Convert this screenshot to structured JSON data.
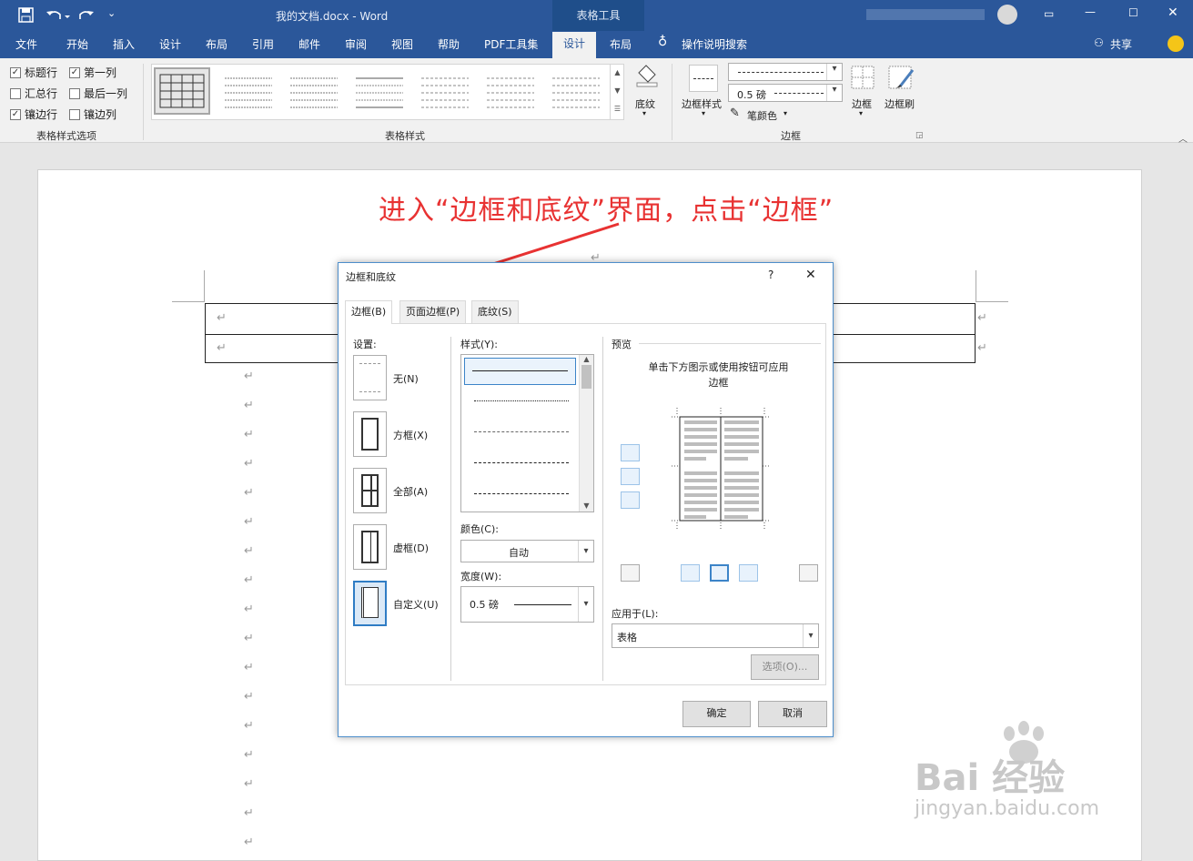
{
  "window": {
    "title": "我的文档.docx  -  Word",
    "context_tab": "表格工具",
    "share_label": "共享",
    "tell_me": "操作说明搜索"
  },
  "tabs": [
    "文件",
    "开始",
    "插入",
    "设计",
    "布局",
    "引用",
    "邮件",
    "审阅",
    "视图",
    "帮助",
    "PDF工具集",
    "设计",
    "布局"
  ],
  "ribbon": {
    "options_group": {
      "label": "表格样式选项",
      "checkboxes": [
        {
          "label": "标题行",
          "checked": true
        },
        {
          "label": "第一列",
          "checked": true
        },
        {
          "label": "汇总行",
          "checked": false
        },
        {
          "label": "最后一列",
          "checked": false
        },
        {
          "label": "镶边行",
          "checked": true
        },
        {
          "label": "镶边列",
          "checked": false
        }
      ]
    },
    "styles_group": {
      "label": "表格样式",
      "shading_label": "底纹"
    },
    "borders_group": {
      "label": "边框",
      "border_style_label": "边框样式",
      "weight_value": "0.5 磅",
      "pen_color_label": "笔颜色",
      "borders_label": "边框",
      "painter_label": "边框刷"
    }
  },
  "annotation": "进入“边框和底纹”界面，点击“边框”",
  "dialog": {
    "title": "边框和底纹",
    "help": "?",
    "close": "✕",
    "tabs": [
      "边框(B)",
      "页面边框(P)",
      "底纹(S)"
    ],
    "settings": {
      "label": "设置:",
      "items": [
        "无(N)",
        "方框(X)",
        "全部(A)",
        "虚框(D)",
        "自定义(U)"
      ]
    },
    "style_label": "样式(Y):",
    "color_label": "颜色(C):",
    "color_value": "自动",
    "width_label": "宽度(W):",
    "width_value": "0.5 磅",
    "preview": {
      "label": "预览",
      "hint": "单击下方图示或使用按钮可应用边框"
    },
    "apply_label": "应用于(L):",
    "apply_value": "表格",
    "options_button": "选项(O)...",
    "ok_button": "确定",
    "cancel_button": "取消"
  },
  "watermark": {
    "brand": "Bai 经验",
    "url": "jingyan.baidu.com"
  },
  "colors": {
    "brand_blue": "#2b579a",
    "annotation_red": "#e83232",
    "dialog_border": "#4d8ecb"
  }
}
